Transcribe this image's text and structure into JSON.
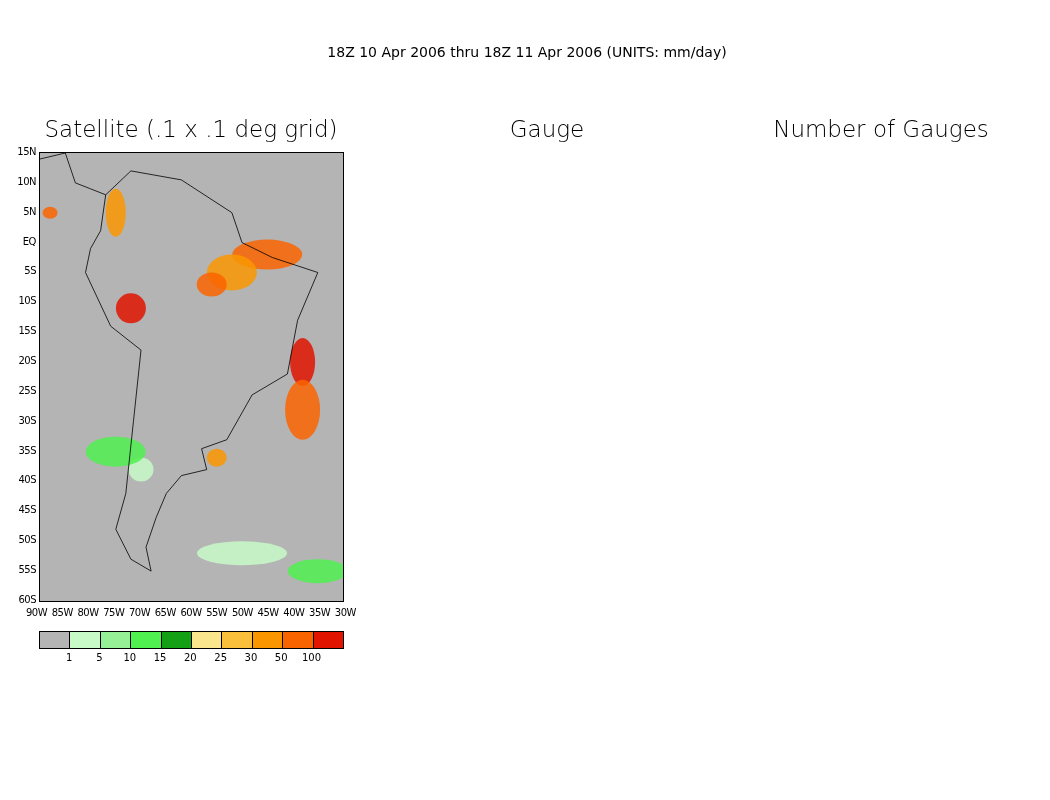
{
  "title": "18Z 10 Apr 2006 thru 18Z 11 Apr 2006 (UNITS: mm/day)",
  "panels": [
    {
      "title": "Satellite (.1 x .1 deg grid)"
    },
    {
      "title": "Gauge"
    },
    {
      "title": "Number of Gauges"
    }
  ],
  "map": {
    "y_ticks": [
      "15N",
      "10N",
      "5N",
      "EQ",
      "5S",
      "10S",
      "15S",
      "20S",
      "25S",
      "30S",
      "35S",
      "40S",
      "45S",
      "50S",
      "55S",
      "60S"
    ],
    "x_ticks": [
      "90W",
      "85W",
      "80W",
      "75W",
      "70W",
      "65W",
      "60W",
      "55W",
      "50W",
      "45W",
      "40W",
      "35W",
      "30W"
    ]
  },
  "legend": {
    "swatches": [
      {
        "color": "#b4b4b4"
      },
      {
        "color": "#c8fac8"
      },
      {
        "color": "#96f096"
      },
      {
        "color": "#50f050"
      },
      {
        "color": "#14a014"
      },
      {
        "color": "#fae68c"
      },
      {
        "color": "#fac03c"
      },
      {
        "color": "#fa9600"
      },
      {
        "color": "#fa6400"
      },
      {
        "color": "#e11400"
      }
    ],
    "labels": [
      "1",
      "5",
      "10",
      "15",
      "20",
      "25",
      "30",
      "50",
      "100"
    ]
  }
}
